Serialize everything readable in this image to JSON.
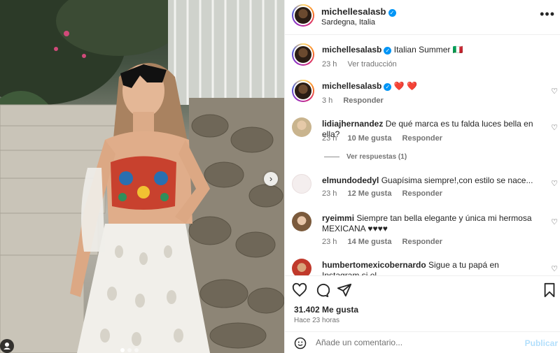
{
  "post": {
    "author": "michellesalasb",
    "location": "Sardegna, Italia",
    "more_icon": "more-icon"
  },
  "comments": [
    {
      "user": "michellesalasb",
      "text": "Italian Summer 🇮🇹",
      "time": "23 h",
      "translate": "Ver traducción",
      "verified": true
    },
    {
      "user": "michellesalasb",
      "text": "❤️ ❤️",
      "time": "3 h",
      "reply": "Responder",
      "verified": true
    },
    {
      "user": "lidiajhernandez",
      "text": "De qué marca es tu falda luces bella en ella?",
      "time": "23 h",
      "likes": "10 Me gusta",
      "reply": "Responder",
      "view_replies": "Ver respuestas (1)"
    },
    {
      "user": "elmundodedyl",
      "text": "Guapísima siempre!,con estilo se nace...",
      "time": "23 h",
      "likes": "12 Me gusta",
      "reply": "Responder"
    },
    {
      "user": "ryeimmi",
      "text": "Siempre tan bella elegante y única mi hermosa MEXICANA ♥♥♥♥",
      "time": "23 h",
      "likes": "14 Me gusta",
      "reply": "Responder"
    },
    {
      "user": "humbertomexicobernardo",
      "text": "Sigue a tu papá en Instagram si el"
    }
  ],
  "actions": {
    "likes": "31.402 Me gusta",
    "ago": "Hace 23 horas"
  },
  "composer": {
    "placeholder": "Añade un comentario...",
    "publish": "Publicar"
  },
  "carousel": {
    "next": "›",
    "slides": 3,
    "active": 0
  },
  "colors": {
    "accent": "#0095f6",
    "heart": "#e0245e"
  }
}
